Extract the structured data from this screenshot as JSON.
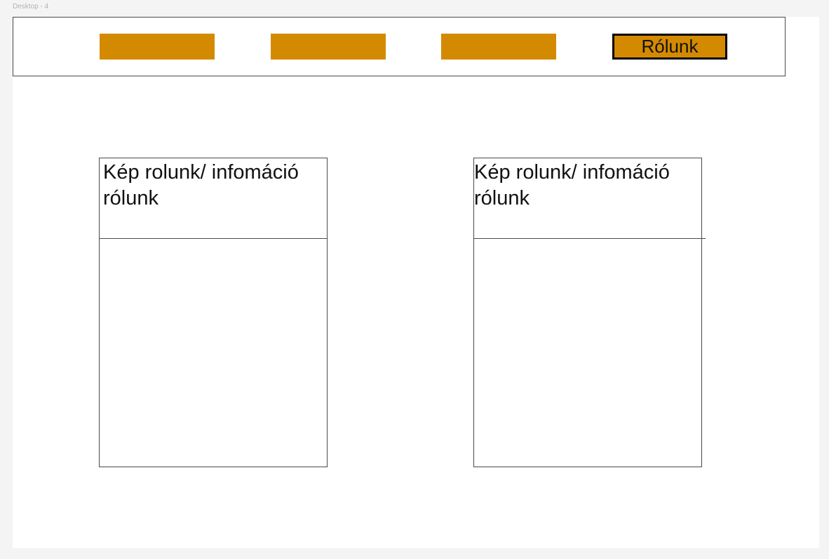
{
  "frame": {
    "label": "Desktop - 4"
  },
  "navbar": {
    "buttons": [
      {
        "label": ""
      },
      {
        "label": ""
      },
      {
        "label": ""
      },
      {
        "label": "Rólunk"
      }
    ]
  },
  "cards": [
    {
      "text": "Kép rolunk/ infomáció rólunk"
    },
    {
      "text": "Kép rolunk/ infomáció rólunk"
    }
  ],
  "colors": {
    "accent": "#d48a00",
    "canvas": "#f4f4f4",
    "frame": "#ffffff",
    "border": "#4a4a4a"
  }
}
